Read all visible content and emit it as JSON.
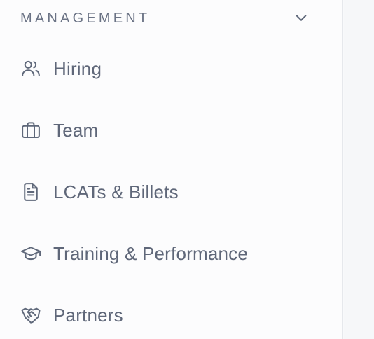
{
  "sidebar": {
    "section_title": "MANAGEMENT",
    "items": [
      {
        "label": "Hiring",
        "icon": "users-icon"
      },
      {
        "label": "Team",
        "icon": "briefcase-icon"
      },
      {
        "label": "LCATs & Billets",
        "icon": "document-icon"
      },
      {
        "label": "Training & Performance",
        "icon": "graduation-cap-icon"
      },
      {
        "label": "Partners",
        "icon": "handshake-icon"
      }
    ]
  },
  "colors": {
    "text": "#5f6779",
    "section_title": "#6b7385",
    "sidebar_bg": "#fcfcfd",
    "main_bg": "#f6f7f9",
    "border": "#e6e8ec"
  }
}
